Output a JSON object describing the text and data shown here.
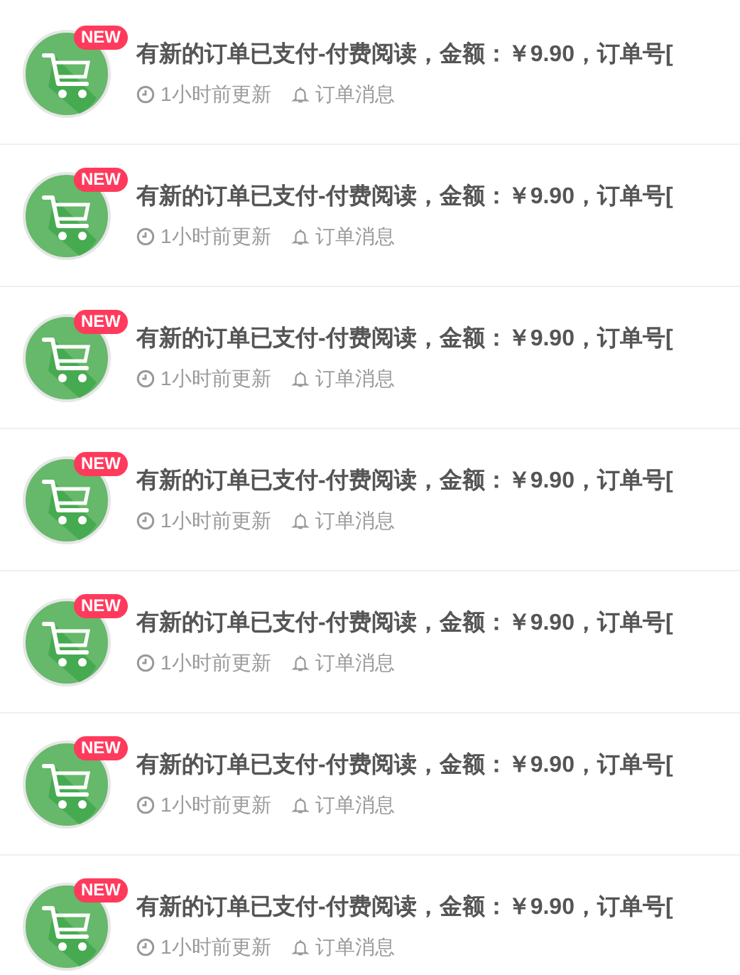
{
  "notifications": [
    {
      "badge": "NEW",
      "title": "有新的订单已支付-付费阅读，金额：￥9.90，订单号[",
      "time": "1小时前更新",
      "category": "订单消息"
    },
    {
      "badge": "NEW",
      "title": "有新的订单已支付-付费阅读，金额：￥9.90，订单号[",
      "time": "1小时前更新",
      "category": "订单消息"
    },
    {
      "badge": "NEW",
      "title": "有新的订单已支付-付费阅读，金额：￥9.90，订单号[",
      "time": "1小时前更新",
      "category": "订单消息"
    },
    {
      "badge": "NEW",
      "title": "有新的订单已支付-付费阅读，金额：￥9.90，订单号[",
      "time": "1小时前更新",
      "category": "订单消息"
    },
    {
      "badge": "NEW",
      "title": "有新的订单已支付-付费阅读，金额：￥9.90，订单号[",
      "time": "1小时前更新",
      "category": "订单消息"
    },
    {
      "badge": "NEW",
      "title": "有新的订单已支付-付费阅读，金额：￥9.90，订单号[",
      "time": "1小时前更新",
      "category": "订单消息"
    },
    {
      "badge": "NEW",
      "title": "有新的订单已支付-付费阅读，金额：￥9.90，订单号[",
      "time": "1小时前更新",
      "category": "订单消息"
    }
  ]
}
